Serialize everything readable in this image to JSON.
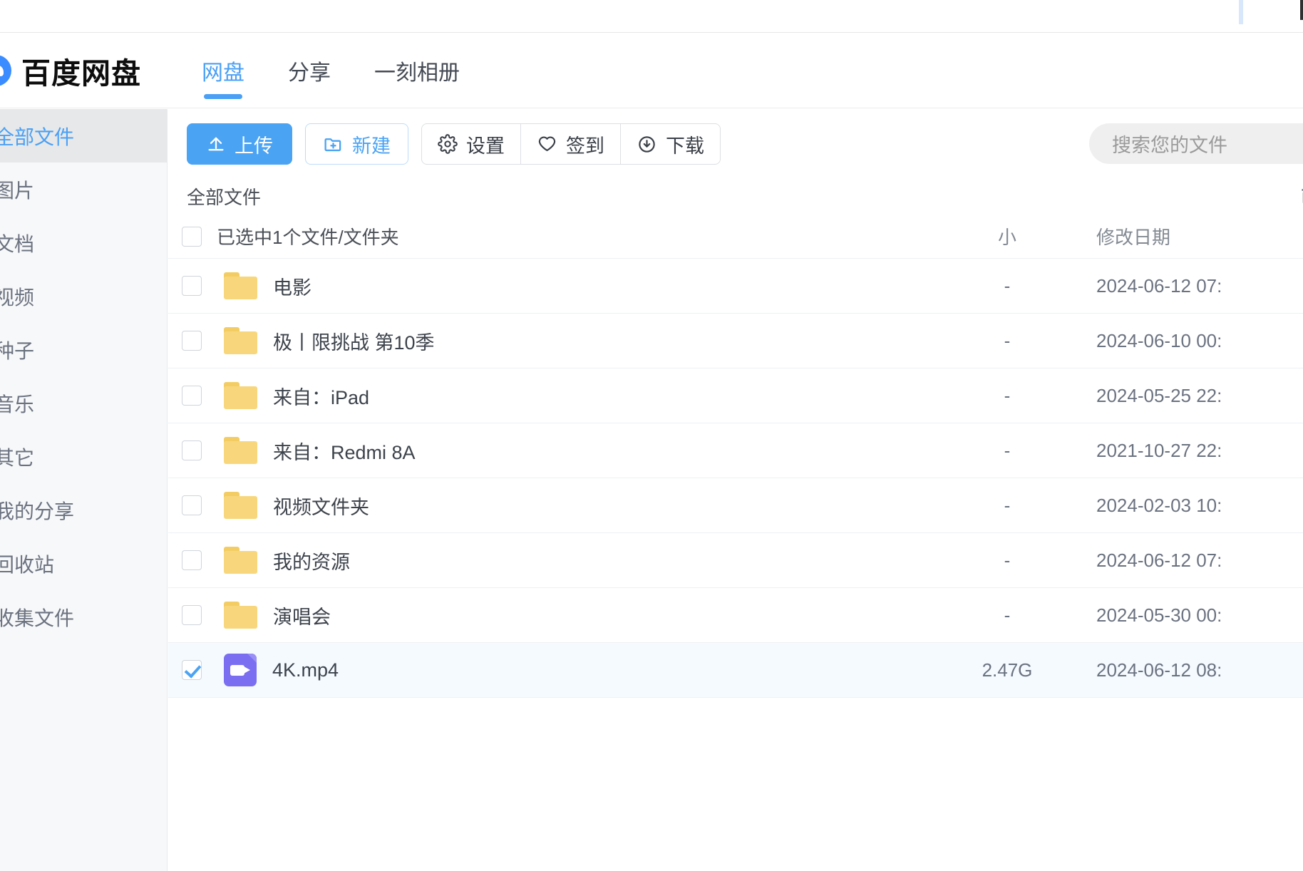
{
  "app": {
    "brand": "百度网盘",
    "logo_color": "#3b8cff"
  },
  "nav": {
    "tabs": [
      {
        "label": "网盘",
        "active": true
      },
      {
        "label": "分享",
        "active": false
      },
      {
        "label": "一刻相册",
        "active": false
      }
    ]
  },
  "sidebar": {
    "items": [
      {
        "label": "全部文件",
        "active": true
      },
      {
        "label": "图片",
        "active": false
      },
      {
        "label": "文档",
        "active": false
      },
      {
        "label": "视频",
        "active": false
      },
      {
        "label": "种子",
        "active": false
      },
      {
        "label": "音乐",
        "active": false
      },
      {
        "label": "其它",
        "active": false
      },
      {
        "label": "我的分享",
        "active": false
      },
      {
        "label": "回收站",
        "active": false
      },
      {
        "label": "收集文件",
        "active": false
      }
    ]
  },
  "toolbar": {
    "upload_label": "上传",
    "new_label": "新建",
    "settings_label": "设置",
    "checkin_label": "签到",
    "download_label": "下载"
  },
  "search": {
    "placeholder": "搜索您的文件",
    "value": ""
  },
  "breadcrumb": {
    "path": "全部文件",
    "right_text": "已"
  },
  "file_list": {
    "columns": {
      "name": "已选中1个文件/文件夹",
      "size": "小",
      "date": "修改日期"
    },
    "select_all_checked": false,
    "rows": [
      {
        "name": "电影",
        "icon": "folder-icon",
        "size": "-",
        "date": "2024-06-12 07:",
        "selected": false
      },
      {
        "name": "极丨限挑战 第10季",
        "icon": "folder-icon",
        "size": "-",
        "date": "2024-06-10 00:",
        "selected": false
      },
      {
        "name": "来自：iPad",
        "icon": "folder-icon",
        "size": "-",
        "date": "2024-05-25 22:",
        "selected": false
      },
      {
        "name": "来自：Redmi 8A",
        "icon": "folder-icon",
        "size": "-",
        "date": "2021-10-27 22:",
        "selected": false
      },
      {
        "name": "视频文件夹",
        "icon": "folder-icon",
        "size": "-",
        "date": "2024-02-03 10:",
        "selected": false
      },
      {
        "name": "我的资源",
        "icon": "folder-icon",
        "size": "-",
        "date": "2024-06-12 07:",
        "selected": false
      },
      {
        "name": "演唱会",
        "icon": "folder-icon",
        "size": "-",
        "date": "2024-05-30 00:",
        "selected": false
      },
      {
        "name": "4K.mp4",
        "icon": "video-icon",
        "size": "2.47G",
        "date": "2024-06-12 08:",
        "selected": true
      }
    ]
  },
  "colors": {
    "accent": "#4aa0f5",
    "folder": "#f8d77c",
    "video": "#7b6ef0",
    "sidebar_bg": "#f7f8f9",
    "selected_row": "#f4fafe"
  }
}
